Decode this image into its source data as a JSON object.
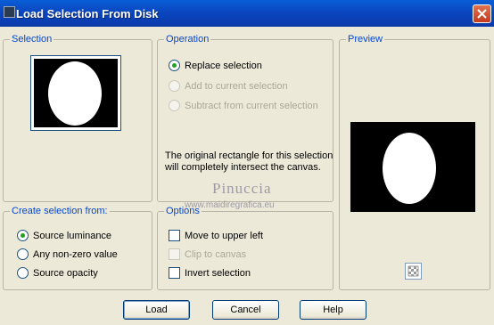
{
  "window": {
    "title": "Load Selection From Disk"
  },
  "selection_group": {
    "label": "Selection"
  },
  "operation_group": {
    "label": "Operation",
    "options": [
      {
        "label": "Replace selection",
        "checked": true,
        "enabled": true
      },
      {
        "label": "Add to current selection",
        "checked": false,
        "enabled": false
      },
      {
        "label": "Subtract from current selection",
        "checked": false,
        "enabled": false
      }
    ],
    "note": "The original rectangle for this selection will completely intersect the canvas."
  },
  "preview_group": {
    "label": "Preview"
  },
  "create_group": {
    "label": "Create selection from:",
    "options": [
      {
        "label": "Source luminance",
        "checked": true
      },
      {
        "label": "Any non-zero value",
        "checked": false
      },
      {
        "label": "Source opacity",
        "checked": false
      }
    ]
  },
  "options_group": {
    "label": "Options",
    "items": [
      {
        "label": "Move to upper left",
        "checked": false,
        "enabled": true
      },
      {
        "label": "Clip to canvas",
        "checked": false,
        "enabled": false
      },
      {
        "label": "Invert selection",
        "checked": false,
        "enabled": true
      }
    ]
  },
  "watermark": {
    "name": "Pinuccia",
    "url": "www.maidiregrafica.eu"
  },
  "buttons": {
    "load": "Load",
    "cancel": "Cancel",
    "help": "Help"
  },
  "colors": {
    "title_bar": "#0a46c0",
    "group_label": "#0046d5",
    "accent_radio": "#21a121",
    "close_button": "#c4391f"
  }
}
